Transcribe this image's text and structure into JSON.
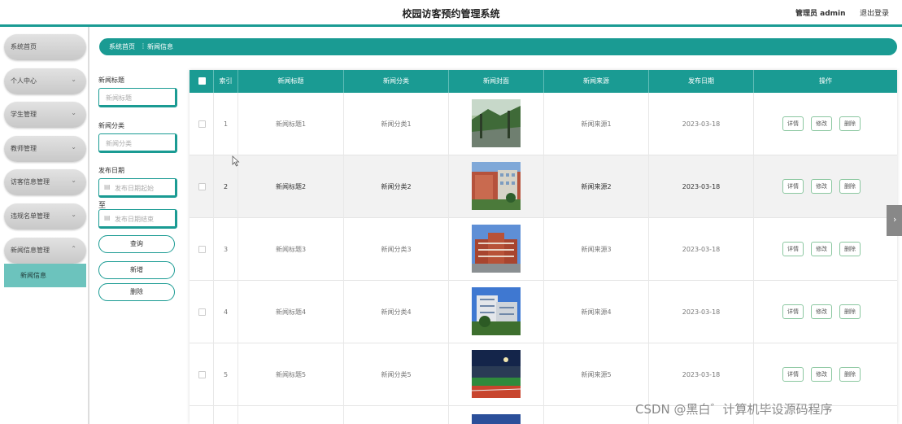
{
  "header": {
    "title": "校园访客预约管理系统",
    "admin": "管理员 admin",
    "logout": "退出登录"
  },
  "sidebar": {
    "items": [
      {
        "label": "系统首页",
        "chevron": ""
      },
      {
        "label": "个人中心",
        "chevron": "⌄"
      },
      {
        "label": "学生管理",
        "chevron": "⌄"
      },
      {
        "label": "教师管理",
        "chevron": "⌄"
      },
      {
        "label": "访客信息管理",
        "chevron": "⌄"
      },
      {
        "label": "违规名单管理",
        "chevron": "⌄"
      },
      {
        "label": "新闻信息管理",
        "chevron": "⌃"
      }
    ],
    "submenu": "新闻信息"
  },
  "breadcrumb": {
    "home": "系统首页",
    "sep": "⋮",
    "current": "新闻信息"
  },
  "filters": {
    "title_label": "新闻标题",
    "title_placeholder": "新闻标题",
    "category_label": "新闻分类",
    "category_placeholder": "新闻分类",
    "date_label": "发布日期",
    "date_start_placeholder": "发布日期起始",
    "to_label": "至",
    "date_end_placeholder": "发布日期结束",
    "query": "查询",
    "add": "新增",
    "delete": "删除"
  },
  "table": {
    "headers": [
      "索引",
      "新闻标题",
      "新闻分类",
      "新闻封面",
      "新闻来源",
      "发布日期",
      "操作"
    ],
    "rows": [
      {
        "index": "1",
        "title": "新闻标题1",
        "category": "新闻分类1",
        "source": "新闻来源1",
        "date": "2023-03-18"
      },
      {
        "index": "2",
        "title": "新闻标题2",
        "category": "新闻分类2",
        "source": "新闻来源2",
        "date": "2023-03-18"
      },
      {
        "index": "3",
        "title": "新闻标题3",
        "category": "新闻分类3",
        "source": "新闻来源3",
        "date": "2023-03-18"
      },
      {
        "index": "4",
        "title": "新闻标题4",
        "category": "新闻分类4",
        "source": "新闻来源4",
        "date": "2023-03-18"
      },
      {
        "index": "5",
        "title": "新闻标题5",
        "category": "新闻分类5",
        "source": "新闻来源5",
        "date": "2023-03-18"
      }
    ],
    "ops": {
      "detail": "详情",
      "edit": "修改",
      "delete": "删除"
    }
  },
  "side_tab": "›",
  "watermark": "CSDN @黑白゛计算机毕设源码程序",
  "colors": {
    "accent": "#1a9b93",
    "submenu": "#6cc3bd"
  }
}
